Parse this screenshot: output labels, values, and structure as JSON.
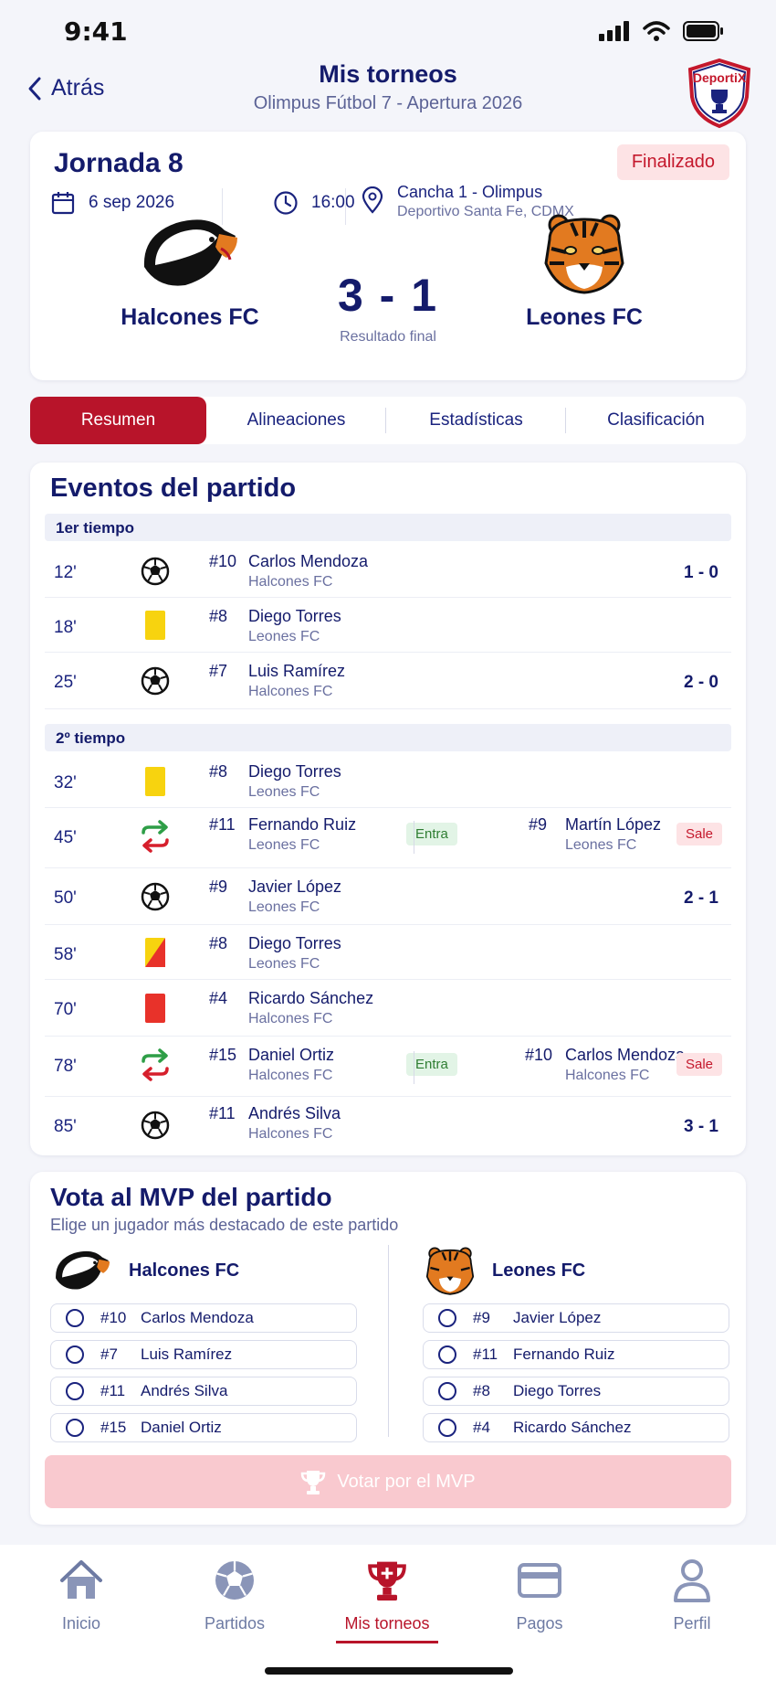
{
  "status": {
    "time": "9:41"
  },
  "header": {
    "back_label": "Atrás",
    "title": "Mis torneos",
    "subtitle": "Olimpus Fútbol 7 - Apertura 2026",
    "logo_text": "DeportiX"
  },
  "match": {
    "round": "Jornada 8",
    "status": "Finalizado",
    "date": "6 sep 2026",
    "time": "16:00",
    "venue": "Cancha 1 - Olimpus",
    "venue_detail": "Deportivo Santa Fe, CDMX",
    "home_team": "Halcones FC",
    "away_team": "Leones FC",
    "score": "3 - 1",
    "score_label": "Resultado final"
  },
  "tabs": [
    "Resumen",
    "Alineaciones",
    "Estadísticas",
    "Clasificación"
  ],
  "events": {
    "title": "Eventos del partido",
    "first_half": "1er tiempo",
    "second_half": "2º tiempo",
    "entra_label": "Entra",
    "sale_label": "Sale",
    "items": [
      {
        "minute": "12'",
        "type": "goal-icon",
        "number": "#10",
        "player": "Carlos Mendoza",
        "team": "Halcones FC",
        "result": "1 - 0"
      },
      {
        "minute": "18'",
        "type": "yellow-card-icon",
        "number": "#8",
        "player": "Diego Torres",
        "team": "Leones FC",
        "result": ""
      },
      {
        "minute": "25'",
        "type": "goal-icon",
        "number": "#7",
        "player": "Luis Ramírez",
        "team": "Halcones FC",
        "result": "2 - 0"
      },
      {
        "minute": "32'",
        "type": "yellow-card-icon",
        "number": "#8",
        "player": "Diego Torres",
        "team": "Leones FC",
        "result": ""
      },
      {
        "minute": "45'",
        "type": "substitution-icon",
        "number": "#11",
        "player": "Fernando Ruiz",
        "team": "Leones FC",
        "out_number": "#9",
        "out_player": "Martín López",
        "out_team": "Leones FC"
      },
      {
        "minute": "50'",
        "type": "goal-icon",
        "number": "#9",
        "player": "Javier López",
        "team": "Leones FC",
        "result": "2 - 1"
      },
      {
        "minute": "58'",
        "type": "second-yellow-card-icon",
        "number": "#8",
        "player": "Diego Torres",
        "team": "Leones FC",
        "result": ""
      },
      {
        "minute": "70'",
        "type": "red-card-icon",
        "number": "#4",
        "player": "Ricardo Sánchez",
        "team": "Halcones FC",
        "result": ""
      },
      {
        "minute": "78'",
        "type": "substitution-icon",
        "number": "#15",
        "player": "Daniel Ortiz",
        "team": "Halcones FC",
        "out_number": "#10",
        "out_player": "Carlos Mendoza",
        "out_team": "Halcones FC"
      },
      {
        "minute": "85'",
        "type": "goal-icon",
        "number": "#11",
        "player": "Andrés Silva",
        "team": "Halcones FC",
        "result": "3 - 1"
      }
    ]
  },
  "mvp": {
    "title": "Vota al MVP del partido",
    "subtitle": "Elige un jugador más destacado de este partido",
    "home": {
      "team": "Halcones FC",
      "players": [
        {
          "number": "#10",
          "name": "Carlos Mendoza"
        },
        {
          "number": "#7",
          "name": "Luis Ramírez"
        },
        {
          "number": "#11",
          "name": "Andrés Silva"
        },
        {
          "number": "#15",
          "name": "Daniel Ortiz"
        }
      ]
    },
    "away": {
      "team": "Leones FC",
      "players": [
        {
          "number": "#9",
          "name": "Javier López"
        },
        {
          "number": "#11",
          "name": "Fernando Ruiz"
        },
        {
          "number": "#8",
          "name": "Diego Torres"
        },
        {
          "number": "#4",
          "name": "Ricardo Sánchez"
        }
      ]
    },
    "vote_button": "Votar por el MVP"
  },
  "nav": {
    "items": [
      "Inicio",
      "Partidos",
      "Mis torneos",
      "Pagos",
      "Perfil"
    ],
    "active": "Mis torneos"
  },
  "colors": {
    "accent": "#b8142a",
    "navy": "#141b6b",
    "bg": "#f4f5fa"
  }
}
